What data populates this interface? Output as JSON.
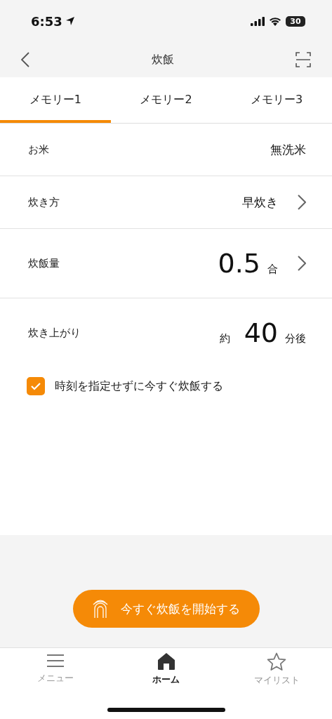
{
  "status_bar": {
    "time": "6:53",
    "battery": "30"
  },
  "nav_bar": {
    "title": "炊飯"
  },
  "tabs": [
    {
      "label": "メモリー1",
      "selected": true
    },
    {
      "label": "メモリー2",
      "selected": false
    },
    {
      "label": "メモリー3",
      "selected": false
    }
  ],
  "settings": [
    {
      "kind": "text",
      "label": "お米",
      "value": "無洗米",
      "chevron": false
    },
    {
      "kind": "text",
      "label": "炊き方",
      "value": "早炊き",
      "chevron": true
    },
    {
      "kind": "big",
      "label": "炊飯量",
      "value": "0.5",
      "unit": "合",
      "chevron": true
    },
    {
      "kind": "big",
      "label": "炊き上がり",
      "prefix": "約",
      "value": "40",
      "unit": "分後",
      "chevron": false
    }
  ],
  "option": {
    "label": "時刻を指定せずに今すぐ炊飯する",
    "checked": true
  },
  "start_button": {
    "label": "今すぐ炊飯を開始する"
  },
  "bottom_nav": [
    {
      "kind": "menu",
      "label": "メニュー",
      "selected": false
    },
    {
      "kind": "home",
      "label": "ホーム",
      "selected": true
    },
    {
      "kind": "star",
      "label": "マイリスト",
      "selected": false
    }
  ]
}
